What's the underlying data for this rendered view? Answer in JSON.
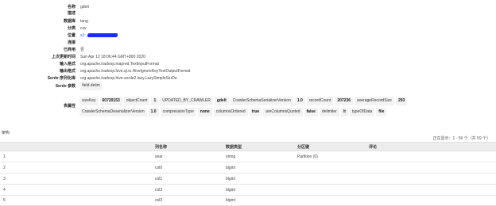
{
  "properties": [
    {
      "key": "名称",
      "value": "gdelt"
    },
    {
      "key": "描述",
      "value": ""
    },
    {
      "key": "数据库",
      "value": "tang"
    },
    {
      "key": "分类",
      "value": "csv"
    },
    {
      "key": "位置",
      "value": "s3:"
    },
    {
      "key": "连接",
      "value": ""
    },
    {
      "key": "已弃用",
      "value": "否"
    },
    {
      "key": "上次更新时间",
      "value": "Sun Apr 12 18:06:44 GMT+800 2020"
    },
    {
      "key": "输入格式",
      "value": "org.apache.hadoop.mapred.TextInputFormat"
    },
    {
      "key": "输出格式",
      "value": "org.apache.hadoop.hive.ql.io.HiveIgnoreKeyTextOutputFormat"
    },
    {
      "key": "Serde 序列化库",
      "value": "org.apache.hadoop.hive.serde2.lazy.LazySimpleSerDe"
    }
  ],
  "serde_params": {
    "label": "Serde 参数",
    "value": "field.delim"
  },
  "table_properties": {
    "label": "表属性",
    "row1": [
      {
        "k": "sizeKey",
        "v": "60720153"
      },
      {
        "k": "objectCount",
        "v": "1"
      },
      {
        "k": "UPDATED_BY_CRAWLER",
        "v": "gdelt"
      },
      {
        "k": "CrawlerSchemaSerializerVersion",
        "v": "1.0"
      },
      {
        "k": "recordCount",
        "v": "207236"
      },
      {
        "k": "averageRecordSize",
        "v": "293"
      }
    ],
    "row2": [
      {
        "k": "CrawlerSchemaDeserializerVersion",
        "v": "1.0"
      },
      {
        "k": "compressionType",
        "v": "none"
      },
      {
        "k": "columnsOrdered",
        "v": "true"
      },
      {
        "k": "areColumnsQuoted",
        "v": "false"
      },
      {
        "k": "delimiter",
        "v": "\\t"
      },
      {
        "k": "typeOfData",
        "v": "file"
      }
    ]
  },
  "schema": {
    "title": "架构",
    "pager": "正在显示：1 - 59 个（共 59 个）",
    "headers": [
      "",
      "列名称",
      "数据类型",
      "分区键",
      "评论"
    ],
    "rows": [
      [
        "1",
        "year",
        "string",
        "Partition (0)",
        ""
      ],
      [
        "2",
        "col0",
        "bigint",
        "",
        ""
      ],
      [
        "3",
        "col1",
        "bigint",
        "",
        ""
      ],
      [
        "4",
        "col2",
        "bigint",
        "",
        ""
      ],
      [
        "5",
        "col3",
        "bigint",
        "",
        ""
      ]
    ]
  },
  "colors": {
    "link": "#2a6ebb",
    "redaction": "#1a2bff",
    "header_bg": "#ededed",
    "pill_bg": "#f3f3f3"
  }
}
